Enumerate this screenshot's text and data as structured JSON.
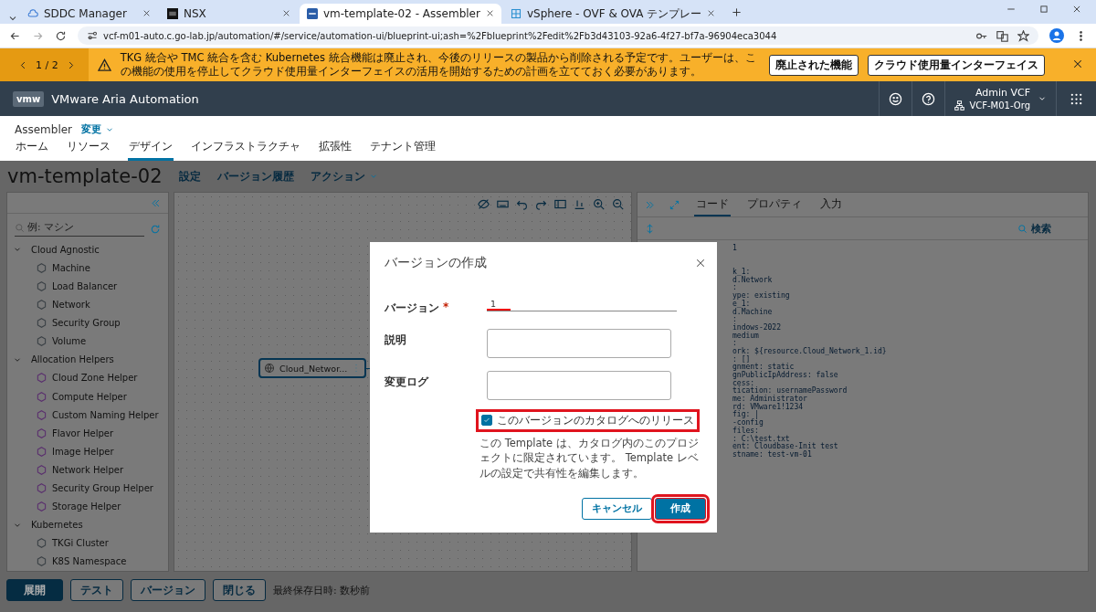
{
  "browser": {
    "tabs": [
      {
        "title": "SDDC Manager",
        "selected": false
      },
      {
        "title": "NSX",
        "selected": false
      },
      {
        "title": "vm-template-02 - Assembler",
        "selected": true
      },
      {
        "title": "vSphere - OVF & OVA テンプレー",
        "selected": false
      }
    ],
    "url": "vcf-m01-auto.c.go-lab.jp/automation/#/service/automation-ui/blueprint-ui;ash=%2Fblueprint%2Fedit%2Fb3d43103-92a6-4f27-bf7a-96904eca3044"
  },
  "banner": {
    "pager": "1 / 2",
    "message": "TKG 統合や TMC 統合を含む Kubernetes 統合機能は廃止され、今後のリリースの製品から削除される予定です。ユーザーは、この機能の使用を停止してクラウド使用量インターフェイスの活用を開始するための計画を立てておく必要があります。",
    "buttons": [
      "廃止された機能",
      "クラウド使用量インターフェイス"
    ]
  },
  "header": {
    "logo": "vmw",
    "product": "VMware Aria Automation",
    "user": "Admin VCF",
    "org": "VCF-M01-Org"
  },
  "subheader": {
    "service": "Assembler",
    "switch": "変更"
  },
  "nav": [
    {
      "label": "ホーム",
      "selected": false
    },
    {
      "label": "リソース",
      "selected": false
    },
    {
      "label": "デザイン",
      "selected": true
    },
    {
      "label": "インフラストラクチャ",
      "selected": false
    },
    {
      "label": "拡張性",
      "selected": false
    },
    {
      "label": "テナント管理",
      "selected": false
    }
  ],
  "page": {
    "title": "vm-template-02",
    "actions": [
      "設定",
      "バージョン履歴",
      "アクション"
    ]
  },
  "palette": {
    "search_placeholder": "例: マシン",
    "categories": [
      {
        "label": "Cloud Agnostic",
        "expanded": true,
        "children": [
          {
            "label": "Machine",
            "color": "#3a4045"
          },
          {
            "label": "Load Balancer",
            "color": "#3a4045"
          },
          {
            "label": "Network",
            "color": "#3a4045"
          },
          {
            "label": "Security Group",
            "color": "#3a4045"
          },
          {
            "label": "Volume",
            "color": "#3a4045"
          }
        ]
      },
      {
        "label": "Allocation Helpers",
        "expanded": true,
        "children": [
          {
            "label": "Cloud Zone Helper",
            "color": "#5a2f6e"
          },
          {
            "label": "Compute Helper",
            "color": "#5a2f6e"
          },
          {
            "label": "Custom Naming Helper",
            "color": "#5a2f6e"
          },
          {
            "label": "Flavor Helper",
            "color": "#5a2f6e"
          },
          {
            "label": "Image Helper",
            "color": "#5a2f6e"
          },
          {
            "label": "Network Helper",
            "color": "#5a2f6e"
          },
          {
            "label": "Security Group Helper",
            "color": "#5a2f6e"
          },
          {
            "label": "Storage Helper",
            "color": "#5a2f6e"
          }
        ]
      },
      {
        "label": "Kubernetes",
        "expanded": true,
        "children": [
          {
            "label": "TKGi Cluster",
            "color": "#3a4045"
          },
          {
            "label": "K8S Namespace",
            "color": "#3a4045"
          }
        ]
      }
    ]
  },
  "canvas": {
    "nodes": [
      {
        "label": "Cloud_Networ..."
      }
    ]
  },
  "code_panel": {
    "tabs": [
      {
        "label": "コード",
        "selected": true
      },
      {
        "label": "プロパティ",
        "selected": false
      },
      {
        "label": "入力",
        "selected": false
      }
    ],
    "search": "検索",
    "lines": [
      "1",
      "k_1:",
      "d.Network",
      ":",
      "ype: existing",
      "e_1:",
      "d.Machine",
      ":",
      "indows-2022",
      "medium",
      ":",
      "ork: ${resource.Cloud_Network_1.id}",
      ": []",
      "gnment: static",
      "gnPublicIpAddress: false",
      "cess:",
      "tication: usernamePassword",
      "me: Administrator",
      "rd: VMware1!1234",
      "fig: |",
      "-config",
      "files:",
      ": C:\\test.txt",
      "ent: Cloudbase-Init test",
      "stname: test-vm-01"
    ]
  },
  "footer": {
    "buttons": [
      {
        "label": "展開",
        "kind": "primary"
      },
      {
        "label": "テスト",
        "kind": "secondary"
      },
      {
        "label": "バージョン",
        "kind": "secondary"
      },
      {
        "label": "閉じる",
        "kind": "secondary"
      }
    ],
    "status": "最終保存日時: 数秒前"
  },
  "dialog": {
    "title": "バージョンの作成",
    "fields": [
      {
        "label": "バージョン",
        "required_mark": "*",
        "kind": "input",
        "value": "1",
        "underlined": true
      },
      {
        "label": "説明",
        "kind": "textarea"
      },
      {
        "label": "変更ログ",
        "kind": "textarea"
      }
    ],
    "release": {
      "label": "このバージョンのカタログへのリリース",
      "checked": true,
      "highlighted": true
    },
    "note": "この Template は、カタログ内のこのプロジェクトに限定されています。 Template レベルの設定で共有性を編集します。",
    "buttons": [
      {
        "label": "キャンセル",
        "kind": "secondary",
        "highlighted": false
      },
      {
        "label": "作成",
        "kind": "primary",
        "highlighted": true
      }
    ]
  }
}
